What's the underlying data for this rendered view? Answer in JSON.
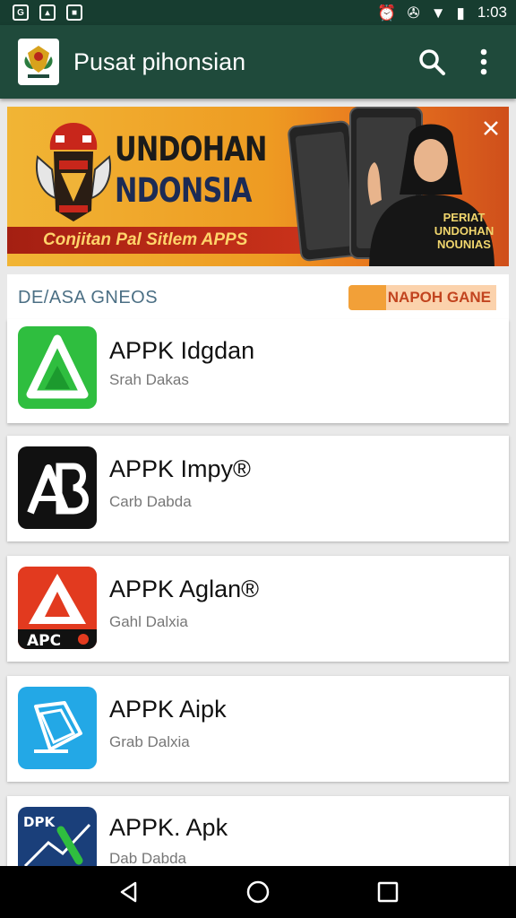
{
  "status_bar": {
    "left_icons": [
      "gallery-notification-icon",
      "image-notification-icon",
      "message-notification-icon"
    ],
    "right_icons": [
      "alarm-icon",
      "vibrate-icon",
      "wifi-icon",
      "battery-icon"
    ],
    "time": "1:03"
  },
  "app_bar": {
    "title": "Pusat pihonsian",
    "actions": [
      "search-icon",
      "overflow-menu-icon"
    ]
  },
  "banner": {
    "headline_1": "UNDOHAN",
    "headline_2": "NDONSIA",
    "strip_text": "Conjitan Pal Sitlem APPS",
    "tag_line_1": "PERIAT",
    "tag_line_2": "UNDOHAN",
    "tag_line_3": "NOUNIAS"
  },
  "section": {
    "title": "DE/ASA GNEOS",
    "more_label": "NAPOH GANE"
  },
  "apps": [
    {
      "name": "APPK Idgdan",
      "subtitle": "Srah Dakas",
      "icon": "green-triangle-app-icon",
      "color": "#2fbe3f"
    },
    {
      "name": "APPK Impy®",
      "subtitle": "Carb Dabda",
      "icon": "ab-logo-app-icon",
      "color": "#111111"
    },
    {
      "name": "APPK Aglan®",
      "subtitle": "Gahl Dalxia",
      "icon": "apco-app-icon",
      "color": "#e23a1f",
      "icon_text": "APC"
    },
    {
      "name": "APPK Aipk",
      "subtitle": "Grab Dalxia",
      "icon": "blue-document-app-icon",
      "color": "#23a8e6"
    },
    {
      "name": "APPK. Apk",
      "subtitle": "Dab Dabda",
      "icon": "dpk-chart-app-icon",
      "color": "#1a3f7a",
      "icon_text": "DPK"
    }
  ],
  "nav_bar": {
    "buttons": [
      "back-icon",
      "home-icon",
      "recents-icon"
    ]
  }
}
